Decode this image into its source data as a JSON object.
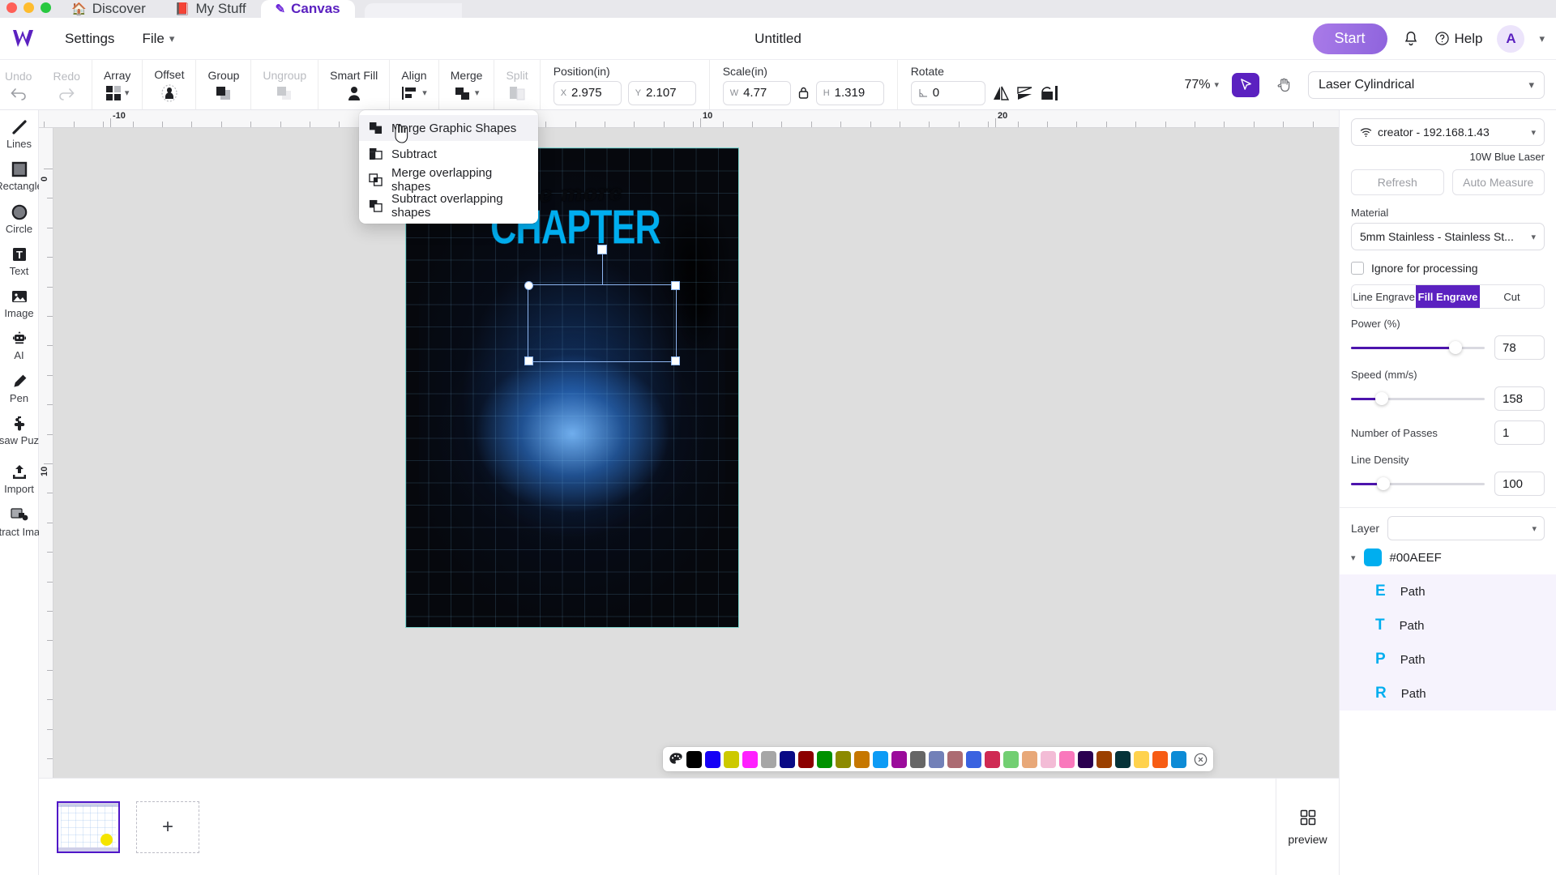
{
  "browser": {
    "tabs": [
      {
        "label": "Discover",
        "icon": "home-icon",
        "active": false
      },
      {
        "label": "My Stuff",
        "icon": "book-icon",
        "active": false
      },
      {
        "label": "Canvas",
        "icon": "canvas-icon",
        "active": true
      }
    ]
  },
  "header": {
    "logo": "wolf-logo",
    "menus": [
      {
        "label": "Settings",
        "caret": false
      },
      {
        "label": "File",
        "caret": true
      }
    ],
    "title": "Untitled",
    "start_label": "Start",
    "help_label": "Help",
    "avatar_initial": "A",
    "accent": "#5b21c0",
    "start_gradient_from": "#a97ae8",
    "start_gradient_to": "#8f63dd"
  },
  "toolbar": {
    "undo_label": "Undo",
    "redo_label": "Redo",
    "array_label": "Array",
    "offset_label": "Offset",
    "group_label": "Group",
    "ungroup_label": "Ungroup",
    "smart_fill_label": "Smart Fill",
    "align_label": "Align",
    "merge_label": "Merge",
    "split_label": "Split",
    "position_label": "Position(in)",
    "scale_label": "Scale(in)",
    "rotate_label": "Rotate",
    "pos_x_key": "X",
    "pos_x_value": "2.975",
    "pos_y_key": "Y",
    "pos_y_value": "2.107",
    "scale_w_key": "W",
    "scale_w_value": "4.77",
    "scale_h_key": "H",
    "scale_h_value": "1.319",
    "rotate_value": "0",
    "zoom_level": "77%",
    "machine": "Laser Cylindrical"
  },
  "merge_menu": {
    "items": [
      {
        "label": "Merge Graphic Shapes",
        "icon": "merge-shapes-icon",
        "highlighted": true
      },
      {
        "label": "Subtract",
        "icon": "subtract-icon",
        "highlighted": false
      },
      {
        "label": "Merge overlapping shapes",
        "icon": "merge-overlap-icon",
        "highlighted": false
      },
      {
        "label": "Subtract overlapping shapes",
        "icon": "subtract-overlap-icon",
        "highlighted": false
      }
    ]
  },
  "rail": {
    "items": [
      {
        "label": "Lines",
        "icon": "line-icon"
      },
      {
        "label": "Rectangle",
        "icon": "rectangle-icon"
      },
      {
        "label": "Circle",
        "icon": "circle-icon"
      },
      {
        "label": "Text",
        "icon": "text-icon"
      },
      {
        "label": "Image",
        "icon": "image-icon"
      },
      {
        "label": "AI",
        "icon": "ai-robot-icon"
      },
      {
        "label": "Pen",
        "icon": "pen-icon"
      },
      {
        "label": "Jigsaw Puzzle",
        "icon": "puzzle-icon"
      },
      {
        "label": "Import",
        "icon": "import-icon"
      },
      {
        "label": "Extract Image",
        "icon": "extract-image-icon"
      }
    ]
  },
  "canvas": {
    "ruler_h_labels": [
      "-10",
      "0",
      "10",
      "20"
    ],
    "ruler_v_labels": [
      "0",
      "10"
    ],
    "artwork": {
      "script_text": "one more",
      "headline_text": "CHAPTER",
      "headline_color": "#00AEEF"
    }
  },
  "right_panel": {
    "device": "creator - 192.168.1.43",
    "laser": "10W Blue Laser",
    "refresh_label": "Refresh",
    "auto_measure_label": "Auto Measure",
    "material_label": "Material",
    "material_value": "5mm Stainless - Stainless St...",
    "ignore_label": "Ignore for processing",
    "ignore_checked": false,
    "modes": [
      {
        "label": "Line Engrave",
        "active": false
      },
      {
        "label": "Fill Engrave",
        "active": true
      },
      {
        "label": "Cut",
        "active": false
      }
    ],
    "params": [
      {
        "label": "Power (%)",
        "value": "78",
        "pct": 78,
        "slider": true
      },
      {
        "label": "Speed (mm/s)",
        "value": "158",
        "pct": 23,
        "slider": true
      },
      {
        "label": "Number of Passes",
        "value": "1",
        "pct": 0,
        "slider": false
      },
      {
        "label": "Line Density",
        "value": "100",
        "pct": 24,
        "slider": true
      }
    ],
    "layer_label": "Layer",
    "layer_value": "",
    "color_group": "#00AEEF",
    "color_swatch": "#00AEEF",
    "paths": [
      {
        "glyph": "E",
        "name": "Path"
      },
      {
        "glyph": "T",
        "name": "Path"
      },
      {
        "glyph": "P",
        "name": "Path"
      },
      {
        "glyph": "R",
        "name": "Path"
      }
    ]
  },
  "bottom": {
    "add_label": "+",
    "preview_label": "preview"
  },
  "palette": {
    "picker_icon": "palette-icon",
    "close_icon": "close-circle-icon",
    "colors": [
      "#000000",
      "#1500f5",
      "#cdc900",
      "#ff1fff",
      "#a6a6a6",
      "#0a0a85",
      "#8c0000",
      "#009100",
      "#8c8a00",
      "#c67700",
      "#0d9bf5",
      "#9b0b9b",
      "#666666",
      "#7280b8",
      "#ac6b72",
      "#3a62e0",
      "#cf2a53",
      "#72cf72",
      "#e8a878",
      "#f3bcd6",
      "#f978bc",
      "#2b0050",
      "#9b4000",
      "#053238",
      "#ffd24d",
      "#f75c14",
      "#0d8bd6"
    ]
  }
}
